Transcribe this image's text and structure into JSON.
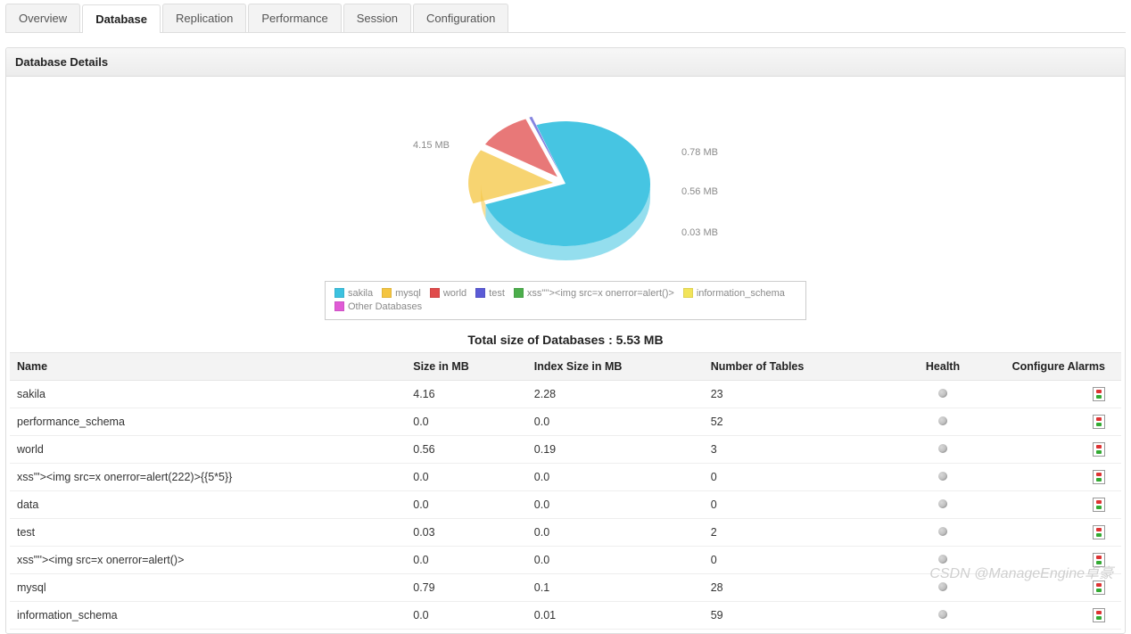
{
  "tabs": [
    {
      "label": "Overview",
      "active": false
    },
    {
      "label": "Database",
      "active": true
    },
    {
      "label": "Replication",
      "active": false
    },
    {
      "label": "Performance",
      "active": false
    },
    {
      "label": "Session",
      "active": false
    },
    {
      "label": "Configuration",
      "active": false
    }
  ],
  "panel": {
    "title": "Database Details",
    "total_label": "Total size of Databases : 5.53 MB"
  },
  "chart_data": {
    "type": "pie",
    "title": "",
    "unit": "MB",
    "slice_labels": [
      "4.15 MB",
      "0.78 MB",
      "0.56 MB",
      "0.03 MB"
    ],
    "series": [
      {
        "name": "sakila",
        "value": 4.15,
        "color": "#3cc2e0"
      },
      {
        "name": "mysql",
        "value": 0.78,
        "color": "#f4c542"
      },
      {
        "name": "world",
        "value": 0.56,
        "color": "#e04b4b"
      },
      {
        "name": "test",
        "value": 0.03,
        "color": "#5b5bd6"
      },
      {
        "name": "xss\"''><img src=x onerror=alert()>",
        "value": 0.0,
        "color": "#4cae4c"
      },
      {
        "name": "information_schema",
        "value": 0.0,
        "color": "#f2e45a"
      },
      {
        "name": "Other Databases",
        "value": 0.0,
        "color": "#e05bd6"
      }
    ]
  },
  "table": {
    "columns": [
      "Name",
      "Size in MB",
      "Index Size in MB",
      "Number of Tables",
      "Health",
      "Configure Alarms"
    ],
    "rows": [
      {
        "name": "sakila",
        "size": "4.16",
        "index_size": "2.28",
        "tables": "23"
      },
      {
        "name": "performance_schema",
        "size": "0.0",
        "index_size": "0.0",
        "tables": "52"
      },
      {
        "name": "world",
        "size": "0.56",
        "index_size": "0.19",
        "tables": "3"
      },
      {
        "name": "xss'\"><img src=x onerror=alert(222)>{{5*5}}",
        "size": "0.0",
        "index_size": "0.0",
        "tables": "0"
      },
      {
        "name": "data",
        "size": "0.0",
        "index_size": "0.0",
        "tables": "0"
      },
      {
        "name": "test",
        "size": "0.03",
        "index_size": "0.0",
        "tables": "2"
      },
      {
        "name": "xss\"''><img src=x onerror=alert()>",
        "size": "0.0",
        "index_size": "0.0",
        "tables": "0"
      },
      {
        "name": "mysql",
        "size": "0.79",
        "index_size": "0.1",
        "tables": "28"
      },
      {
        "name": "information_schema",
        "size": "0.0",
        "index_size": "0.01",
        "tables": "59"
      }
    ]
  },
  "watermark": "CSDN @ManageEngine卓豪"
}
